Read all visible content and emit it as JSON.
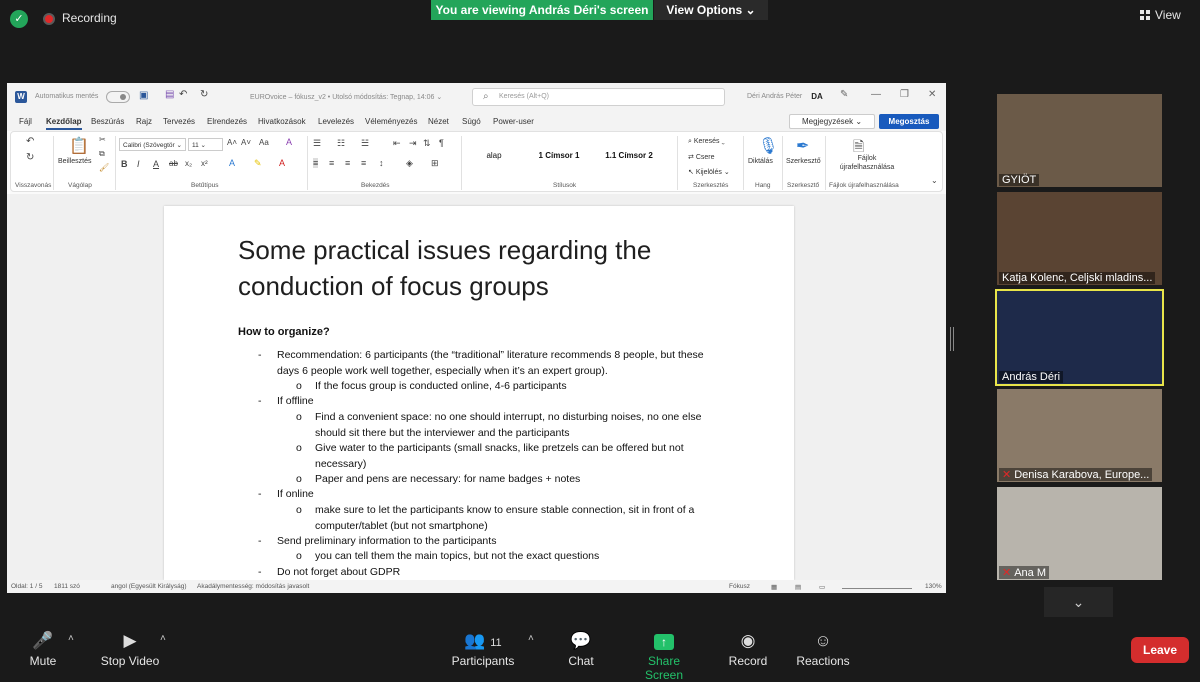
{
  "top": {
    "recording_label": "Recording",
    "share_banner": "You are viewing András Déri's screen",
    "view_options": "View Options ⌄",
    "view_label": "View"
  },
  "word": {
    "autosave": "Automatikus mentés",
    "file_title": "EUROvoice – fókusz_v2 • Utolsó módosítás: Tegnap, 14:06 ⌄",
    "search_placeholder": "Keresés (Alt+Q)",
    "user": "Déri András Péter",
    "user_initials": "DA",
    "menu": [
      "Fájl",
      "Kezdőlap",
      "Beszúrás",
      "Rajz",
      "Tervezés",
      "Elrendezés",
      "Hivatkozások",
      "Levelezés",
      "Véleményezés",
      "Nézet",
      "Súgó",
      "Power-user"
    ],
    "comments_btn": "Megjegyzések ⌄",
    "share_btn": "Megosztás",
    "ribbon": {
      "undo_label": "Visszavonás",
      "paste": "Beillesztés",
      "clipboard": "Vágólap",
      "font_name": "Calibri (Szövegtör ⌄",
      "font_size": "11 ⌄",
      "font_group": "Betűtípus",
      "paragraph_group": "Bekezdés",
      "styles": [
        "alap",
        "1  Címsor 1",
        "1.1  Címsor 2"
      ],
      "styles_group": "Stílusok",
      "find": "Keresés ⌄",
      "replace": "Csere",
      "select": "Kijelölés ⌄",
      "editing_group": "Szerkesztés",
      "dictate": "Diktálás",
      "voice_group": "Hang",
      "editor": "Szerkesztő",
      "editor_group": "Szerkesztő",
      "reuse": "Fájlok újrafelhasználása",
      "reuse_group": "Fájlok újrafelhasználása"
    },
    "doc": {
      "title": "Some practical issues regarding the conduction of focus groups",
      "subhead": "How to organize?",
      "lines": [
        {
          "lvl": 1,
          "marker": "-",
          "text": "Recommendation: 6 participants (the “traditional” literature recommends 8 people, but these days 6 people work well together, especially when it’s an expert group)."
        },
        {
          "lvl": 2,
          "marker": "o",
          "text": "If the focus group is conducted online, 4-6 participants"
        },
        {
          "lvl": 1,
          "marker": "-",
          "text": "If offline"
        },
        {
          "lvl": 2,
          "marker": "o",
          "text": "Find a convenient space: no one should interrupt, no disturbing noises, no one else should sit there but the interviewer and the participants"
        },
        {
          "lvl": 2,
          "marker": "o",
          "text": "Give water to the participants (small snacks, like pretzels can be offered but not necessary)"
        },
        {
          "lvl": 2,
          "marker": "o",
          "text": "Paper and pens are necessary: for name badges + notes"
        },
        {
          "lvl": 1,
          "marker": "-",
          "text": "If online"
        },
        {
          "lvl": 2,
          "marker": "o",
          "text": "make sure to let the participants know to ensure stable connection, sit in front of a computer/tablet (but not smartphone)"
        },
        {
          "lvl": 1,
          "marker": "-",
          "text": "Send preliminary information to the participants"
        },
        {
          "lvl": 2,
          "marker": "o",
          "text": "you can tell them the main topics, but not the exact questions"
        },
        {
          "lvl": 1,
          "marker": "-",
          "text": "Do not forget about GDPR"
        }
      ]
    },
    "status": {
      "page": "Oldal: 1 / 5",
      "words": "1811 szó",
      "language": "angol (Egyesült Királyság)",
      "accessibility": "Akadálymentesség: módosítás javasolt",
      "focus": "Fókusz",
      "zoom": "130%"
    }
  },
  "participants": [
    {
      "name": "GYIÖT",
      "muted": false,
      "bg": "#6b5a48"
    },
    {
      "name": "Katja Kolenc, Celjski mladins...",
      "muted": false,
      "bg": "#5a4433"
    },
    {
      "name": "András Déri",
      "muted": false,
      "bg": "#1e2a4a"
    },
    {
      "name": "Denisa Karabova, Europe...",
      "muted": true,
      "bg": "#8a7a68"
    },
    {
      "name": "Ana M",
      "muted": true,
      "bg": "#b8b4ac"
    }
  ],
  "toolbar": {
    "mute": "Mute",
    "stop_video": "Stop Video",
    "participants": "Participants",
    "participants_count": "11",
    "chat": "Chat",
    "share_screen": "Share Screen",
    "record": "Record",
    "reactions": "Reactions",
    "leave": "Leave"
  }
}
